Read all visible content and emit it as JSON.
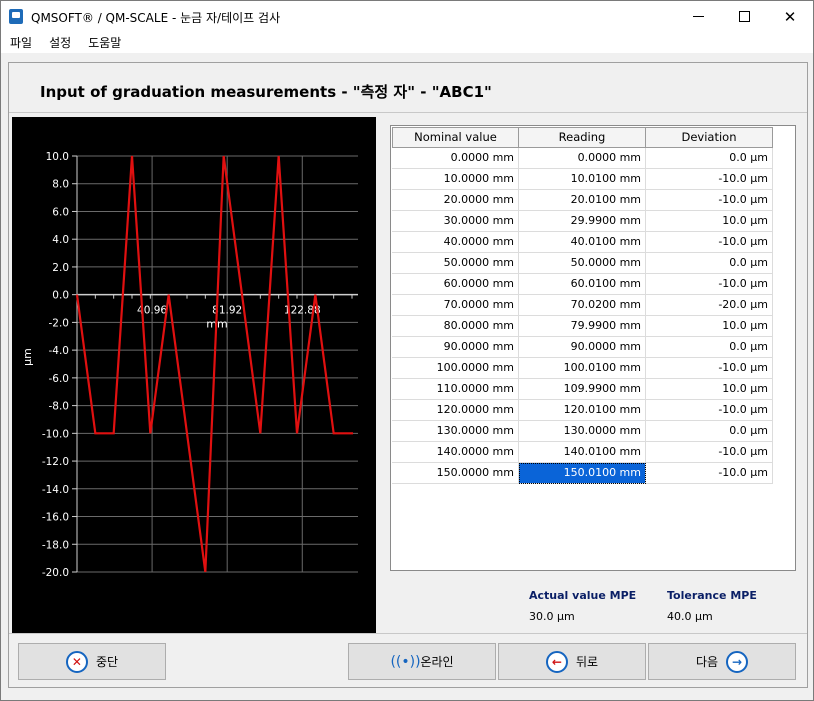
{
  "window": {
    "title": "QMSOFT® / QM-SCALE - 눈금 자/테이프 검사",
    "minimize_glyph": "",
    "close_glyph": "✕"
  },
  "menu": [
    "파일",
    "설정",
    "도움말"
  ],
  "heading": "Input of graduation measurements - \"측정 자\" - \"ABC1\"",
  "chart_data": {
    "type": "line",
    "ylabel": "µm",
    "xlabel": "mm",
    "ylim": [
      -20,
      10
    ],
    "yticks": [
      "10.0",
      "8.0",
      "6.0",
      "4.0",
      "2.0",
      "0.0",
      "-2.0",
      "-4.0",
      "-6.0",
      "-8.0",
      "-10.0",
      "-12.0",
      "-14.0",
      "-16.0",
      "-18.0",
      "-20.0"
    ],
    "xticks": [
      "40.96",
      "81.92",
      "122.88"
    ],
    "grid": true,
    "line_color": "#e01010",
    "x": [
      0,
      10,
      20,
      30,
      40,
      50,
      60,
      70,
      80,
      90,
      100,
      110,
      120,
      130,
      140,
      150
    ],
    "values": [
      0.0,
      -10.0,
      -10.0,
      10.0,
      -10.0,
      0.0,
      -10.0,
      -20.0,
      10.0,
      0.0,
      -10.0,
      10.0,
      -10.0,
      0.0,
      -10.0,
      -10.0
    ]
  },
  "table": {
    "columns": [
      "Nominal value",
      "Reading",
      "Deviation"
    ],
    "rows": [
      [
        "0.0000 mm",
        "0.0000 mm",
        "0.0 µm"
      ],
      [
        "10.0000 mm",
        "10.0100 mm",
        "-10.0 µm"
      ],
      [
        "20.0000 mm",
        "20.0100 mm",
        "-10.0 µm"
      ],
      [
        "30.0000 mm",
        "29.9900 mm",
        "10.0 µm"
      ],
      [
        "40.0000 mm",
        "40.0100 mm",
        "-10.0 µm"
      ],
      [
        "50.0000 mm",
        "50.0000 mm",
        "0.0 µm"
      ],
      [
        "60.0000 mm",
        "60.0100 mm",
        "-10.0 µm"
      ],
      [
        "70.0000 mm",
        "70.0200 mm",
        "-20.0 µm"
      ],
      [
        "80.0000 mm",
        "79.9900 mm",
        "10.0 µm"
      ],
      [
        "90.0000 mm",
        "90.0000 mm",
        "0.0 µm"
      ],
      [
        "100.0000 mm",
        "100.0100 mm",
        "-10.0 µm"
      ],
      [
        "110.0000 mm",
        "109.9900 mm",
        "10.0 µm"
      ],
      [
        "120.0000 mm",
        "120.0100 mm",
        "-10.0 µm"
      ],
      [
        "130.0000 mm",
        "130.0000 mm",
        "0.0 µm"
      ],
      [
        "140.0000 mm",
        "140.0100 mm",
        "-10.0 µm"
      ],
      [
        "150.0000 mm",
        "150.0100 mm",
        "-10.0 µm"
      ]
    ],
    "selected_row": 15,
    "selected_col": 1
  },
  "mpe": {
    "actual_label": "Actual value MPE",
    "actual_value": "30.0 µm",
    "tolerance_label": "Tolerance MPE",
    "tolerance_value": "40.0 µm"
  },
  "buttons": {
    "cancel": "중단",
    "online": "온라인",
    "back": "뒤로",
    "next": "다음"
  },
  "colors": {
    "accent": "#1565c0",
    "selection": "#0a64d8",
    "mpe_label": "#0a1f66"
  }
}
